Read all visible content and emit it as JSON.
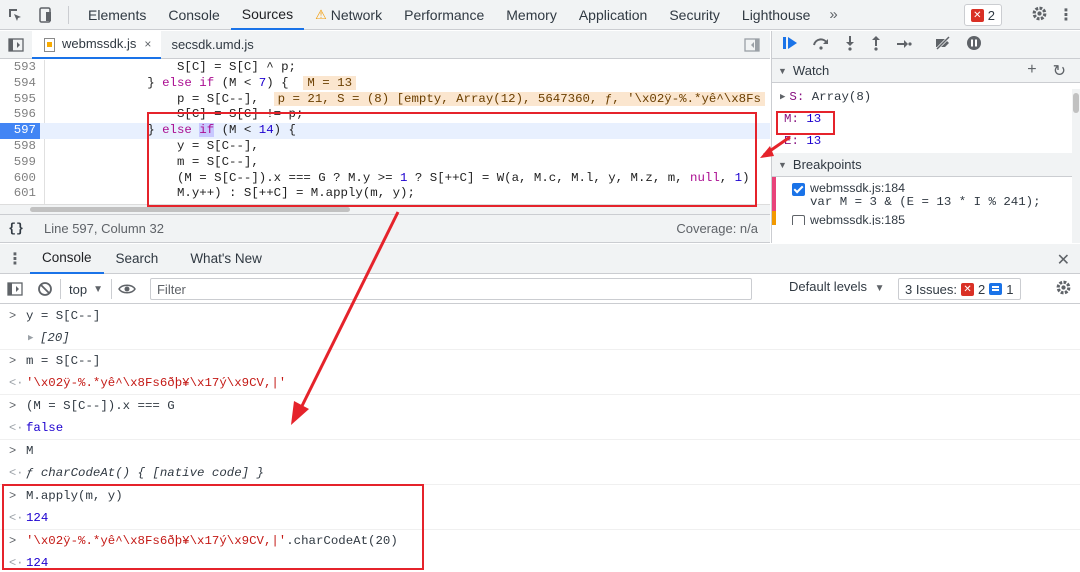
{
  "topbar": {
    "tabs": [
      "Elements",
      "Console",
      "Sources",
      "Network",
      "Performance",
      "Memory",
      "Application",
      "Security",
      "Lighthouse"
    ],
    "active_tab": "Sources",
    "more": "»",
    "error_count": "2"
  },
  "sources": {
    "file_tabs": [
      "webmssdk.js",
      "secsdk.umd.js"
    ],
    "close": "×",
    "code_lines": [
      {
        "n": "593",
        "html": "                S[C] = S[C] ^ p;"
      },
      {
        "n": "594",
        "html": "            } else if (M < 7) {  M = 13"
      },
      {
        "n": "595",
        "html": "                p = S[C--],  p = 21, S = (8) [empty, Array(12), 5647360, ƒ, '\\x02ÿ-%.*yê^\\x8Fs"
      },
      {
        "n": "596",
        "html": "                S[C] = S[C] != p;"
      },
      {
        "n": "597",
        "html": "            } else if (M < 14) {"
      },
      {
        "n": "598",
        "html": "                y = S[C--],"
      },
      {
        "n": "599",
        "html": "                m = S[C--],"
      },
      {
        "n": "600",
        "html": "                (M = S[C--]).x === G ? M.y >= 1 ? S[++C] = W(a, M.c, M.l, y, M.z, m, null, 1)"
      },
      {
        "n": "601",
        "html": "                M.y++) : S[++C] = M.apply(m, y);"
      }
    ],
    "status": {
      "braces": "{}",
      "position": "Line 597, Column 32",
      "coverage": "Coverage: n/a"
    }
  },
  "debugger": {
    "watch": {
      "title": "Watch",
      "add": "+",
      "refresh": "↻",
      "items": [
        {
          "name": "S",
          "value": "Array(8)",
          "expandable": true
        },
        {
          "name": "M",
          "value": "13",
          "expandable": false
        },
        {
          "name": "E",
          "value": "13",
          "expandable": false
        }
      ]
    },
    "breakpoints": {
      "title": "Breakpoints",
      "items": [
        {
          "file": "webmssdk.js:184",
          "code": "var M = 3 & (E = 13 * I % 241);",
          "checked": true,
          "color": "#e8437a"
        },
        {
          "file": "webmssdk.js:185",
          "code": "",
          "checked": false,
          "color": "#f29900"
        }
      ]
    }
  },
  "drawer": {
    "tabs": [
      "Console",
      "Search",
      "What's New"
    ],
    "active": "Console",
    "close": "✕"
  },
  "console_toolbar": {
    "context": "top",
    "filter_placeholder": "Filter",
    "levels": "Default levels",
    "issues_label": "3 Issues:",
    "issues_errors": "2",
    "issues_info": "1"
  },
  "console": {
    "entries": [
      {
        "input": "y = S[C--]",
        "output": "[20]",
        "output_kind": "array"
      },
      {
        "input": "m = S[C--]",
        "output": "'\\x02ÿ-%.*yê^\\x8Fs6ðþ¥\\x17ý\\x9CV,|'",
        "output_kind": "string"
      },
      {
        "input": "(M = S[C--]).x === G",
        "output": "false",
        "output_kind": "kw"
      },
      {
        "input": "M",
        "output": "ƒ charCodeAt() { [native code] }",
        "output_kind": "fn"
      },
      {
        "input": "M.apply(m, y)",
        "output": "124",
        "output_kind": "num"
      },
      {
        "input_str": "'\\x02ÿ-%.*yê^\\x8Fs6ðþ¥\\x17ý\\x9CV,|'",
        "input": ".charCodeAt(20)",
        "output": "124",
        "output_kind": "num"
      }
    ]
  },
  "colors": {
    "accent": "#1a73e8",
    "annotation": "#e5232b",
    "current_line": "#e8f0fe"
  }
}
